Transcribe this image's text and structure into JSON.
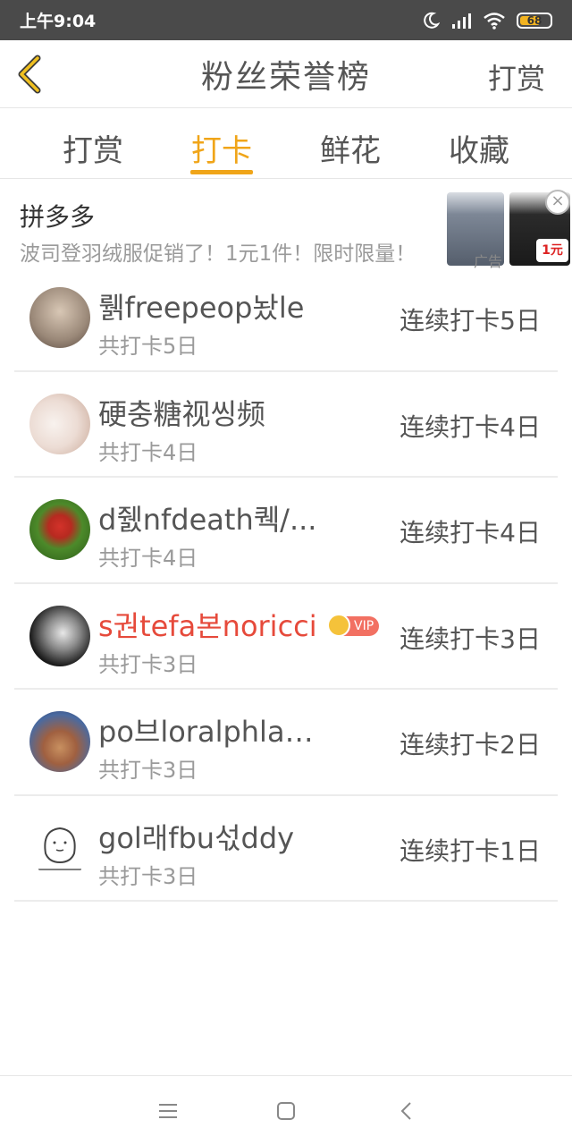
{
  "status_bar": {
    "time": "上午9:04",
    "battery": "68",
    "icons": [
      "moon-icon",
      "signal-icon",
      "wifi-icon",
      "battery-icon"
    ]
  },
  "header": {
    "title": "粉丝荣誉榜",
    "action": "打赏",
    "back_icon": "chevron-left-icon"
  },
  "tabs": [
    {
      "label": "打赏",
      "active": false
    },
    {
      "label": "打卡",
      "active": true
    },
    {
      "label": "鲜花",
      "active": false
    },
    {
      "label": "收藏",
      "active": false
    }
  ],
  "ad": {
    "title": "拼多多",
    "desc": "波司登羽绒服促销了！1元1件！限时限量！",
    "label": "广告",
    "badge": "1元"
  },
  "fans": [
    {
      "name": "뤩freepeop놨le",
      "count": "共打卡5日",
      "streak": "连续打卡5日",
      "vip": false
    },
    {
      "name": "硬충糖视씽频",
      "count": "共打卡4日",
      "streak": "连续打卡4日",
      "vip": false
    },
    {
      "name": "d쥀nfdeath퀙/...",
      "count": "共打卡4日",
      "streak": "连续打卡4日",
      "vip": false
    },
    {
      "name": "s권tefa본noricci",
      "count": "共打卡3日",
      "streak": "连续打卡3日",
      "vip": true,
      "vip_label": "VIP"
    },
    {
      "name": "po브loralphlau...",
      "count": "共打卡3日",
      "streak": "连续打卡2日",
      "vip": false
    },
    {
      "name": "gol래fbu섟ddy",
      "count": "共打卡3日",
      "streak": "连续打卡1日",
      "vip": false
    }
  ],
  "colors": {
    "accent": "#f0a519",
    "vip_name": "#e64a3b",
    "status_bar": "#4a4a4a"
  }
}
